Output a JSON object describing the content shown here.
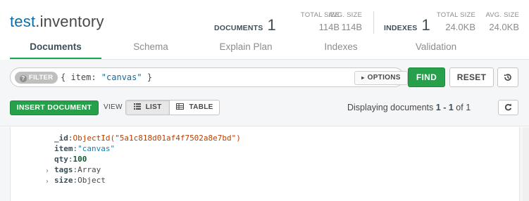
{
  "header": {
    "db_name": "test",
    "collection_sep": ".",
    "collection_name": "inventory",
    "documents": {
      "label": "DOCUMENTS",
      "count": "1"
    },
    "doc_total_size": {
      "label": "TOTAL SIZE",
      "value": "114B"
    },
    "doc_avg_size": {
      "label": "AVG. SIZE",
      "value": "114B"
    },
    "indexes": {
      "label": "INDEXES",
      "count": "1"
    },
    "idx_total_size": {
      "label": "TOTAL SIZE",
      "value": "24.0KB"
    },
    "idx_avg_size": {
      "label": "AVG. SIZE",
      "value": "24.0KB"
    }
  },
  "tabs": [
    {
      "label": "Documents",
      "active": true
    },
    {
      "label": "Schema",
      "active": false
    },
    {
      "label": "Explain Plan",
      "active": false
    },
    {
      "label": "Indexes",
      "active": false
    },
    {
      "label": "Validation",
      "active": false
    }
  ],
  "query": {
    "filter_pill": "FILTER",
    "filter_prefix": "{ item: ",
    "filter_value": "\"canvas\"",
    "filter_suffix": " }",
    "options_label": "OPTIONS",
    "find_label": "FIND",
    "reset_label": "RESET"
  },
  "toolbar": {
    "insert_label": "INSERT DOCUMENT",
    "view_label": "VIEW",
    "list_label": "LIST",
    "table_label": "TABLE",
    "display_prefix": "Displaying documents",
    "display_range": "1 - 1",
    "display_of": "of",
    "display_total": "1"
  },
  "document": {
    "fields": [
      {
        "key": "_id",
        "value": "ObjectId(\"5a1c818d01af4f7502a8e7bd\")",
        "kind": "oid",
        "expandable": false
      },
      {
        "key": "item",
        "value": "\"canvas\"",
        "kind": "str",
        "expandable": false
      },
      {
        "key": "qty",
        "value": "100",
        "kind": "num",
        "expandable": false
      },
      {
        "key": "tags",
        "value": "Array",
        "kind": "type",
        "expandable": true
      },
      {
        "key": "size",
        "value": "Object",
        "kind": "type",
        "expandable": true
      }
    ]
  },
  "colors": {
    "accent_green": "#13aa52",
    "button_green": "#26a04a",
    "db_blue": "#0a6ea8",
    "objectid_orange": "#b84000"
  },
  "icons": {
    "filter_help": "question-circle-icon",
    "options_caret": "caret-right-icon",
    "history": "history-icon",
    "list_view": "list-icon",
    "table_view": "table-icon",
    "refresh": "refresh-icon",
    "expand": "chevron-right-icon"
  }
}
